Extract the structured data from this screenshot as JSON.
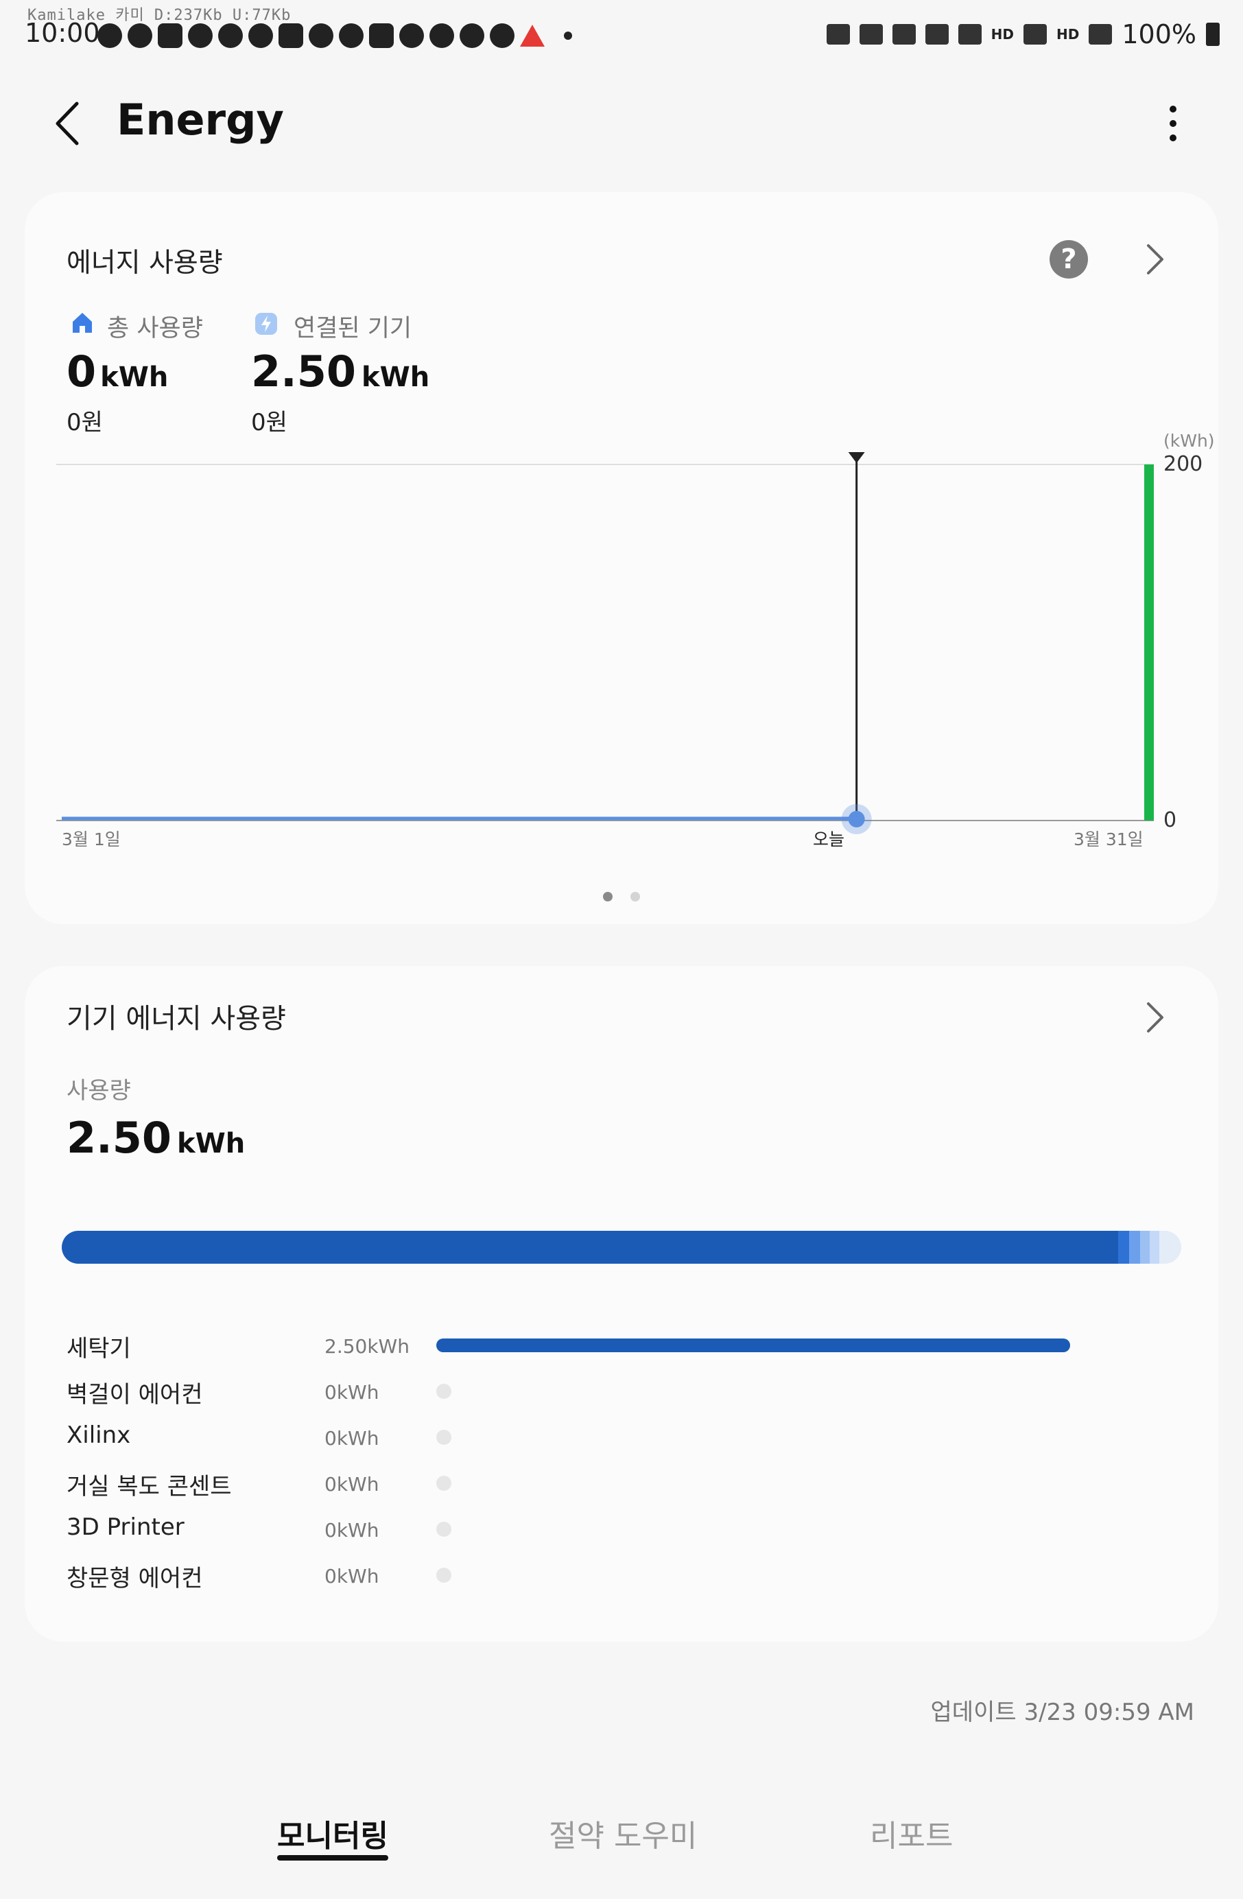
{
  "status_bar": {
    "debug_text": "Kamilake 카미 D:237Kb  U:77Kb",
    "time": "10:00",
    "battery": "100%",
    "hd1": "HD",
    "hd2": "HD"
  },
  "header": {
    "title": "Energy"
  },
  "energy_card": {
    "title": "에너지 사용량",
    "total": {
      "label": "총 사용량",
      "value": "0",
      "unit": "kWh",
      "cost": "0원"
    },
    "connected": {
      "label": "연결된 기기",
      "value": "2.50",
      "unit": "kWh",
      "cost": "0원"
    },
    "chart_data": {
      "type": "line",
      "x_start_label": "3월 1일",
      "x_today_label": "오늘",
      "x_end_label": "3월 31일",
      "y_unit": "(kWh)",
      "y_ticks": [
        "200",
        "0"
      ],
      "ylim": [
        0,
        200
      ],
      "series": [
        {
          "values": [
            0,
            0,
            0,
            0,
            0,
            0,
            0,
            0,
            0,
            0,
            0,
            0,
            0,
            0,
            0,
            0,
            0,
            0,
            0,
            0,
            0,
            0,
            0
          ]
        }
      ],
      "today_day": 23,
      "days": 31,
      "target_bar_value": 200,
      "colors": {
        "line": "#5b8fe0",
        "target": "#1ab54a",
        "marker": "#222222"
      }
    }
  },
  "device_card": {
    "title": "기기 에너지 사용량",
    "usage_label": "사용량",
    "usage_value": "2.50",
    "usage_unit": "kWh",
    "devices": [
      {
        "name": "세탁기",
        "value": "2.50kWh",
        "share": 1.0
      },
      {
        "name": "벽걸이 에어컨",
        "value": "0kWh",
        "share": 0
      },
      {
        "name": "Xilinx",
        "value": "0kWh",
        "share": 0
      },
      {
        "name": "거실 복도 콘센트",
        "value": "0kWh",
        "share": 0
      },
      {
        "name": "3D Printer",
        "value": "0kWh",
        "share": 0
      },
      {
        "name": "창문형 에어컨",
        "value": "0kWh",
        "share": 0
      }
    ],
    "colors": {
      "primary": "#1b5bb6"
    }
  },
  "update_text": "업데이트 3/23 09:59 AM",
  "bottom_nav": {
    "tabs": [
      {
        "label": "모니터링",
        "active": true
      },
      {
        "label": "절약 도우미",
        "active": false
      },
      {
        "label": "리포트",
        "active": false
      }
    ]
  }
}
